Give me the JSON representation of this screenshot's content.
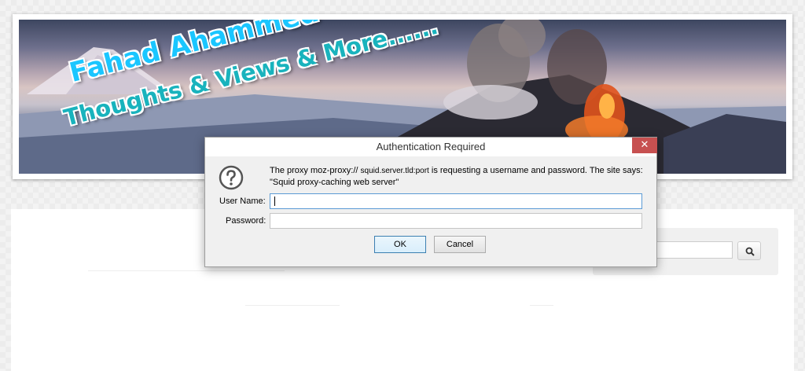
{
  "banner": {
    "brand_name": "Fahad Ahammed",
    "tagline": "Thoughts & Views & More......"
  },
  "search": {
    "value": "",
    "icon": "search-icon"
  },
  "dialog": {
    "title": "Authentication Required",
    "close_label": "✕",
    "icon": "question-icon",
    "message_prefix": "The proxy moz-proxy://",
    "message_host": "squid.server.tld:port",
    "message_suffix": " is requesting a username and password. The site says:",
    "message_realm": "\"Squid proxy-caching web server\"",
    "username_label": "User Name:",
    "username_value": "",
    "password_label": "Password:",
    "password_value": "",
    "ok_label": "OK",
    "cancel_label": "Cancel"
  },
  "colors": {
    "close_button": "#c75050",
    "ok_border": "#3c7fb1",
    "focus_border": "#5b9bd5"
  }
}
